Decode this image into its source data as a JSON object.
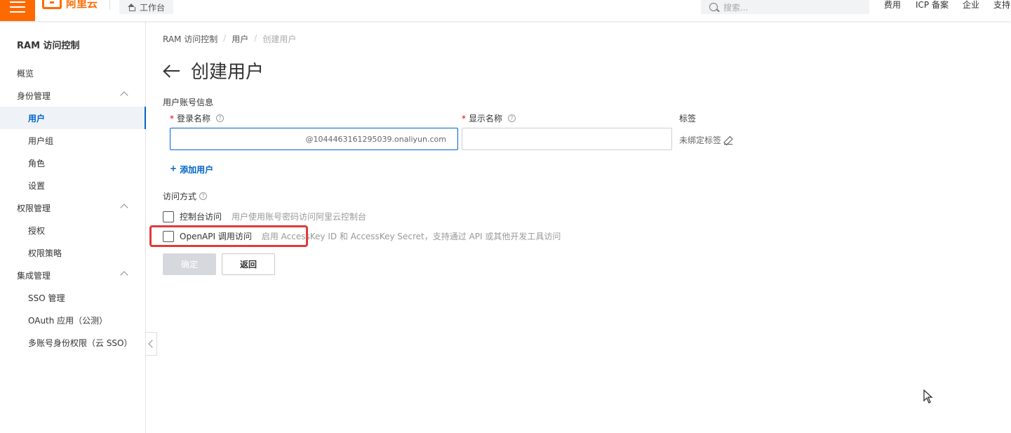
{
  "topbar": {
    "brand": "阿里云",
    "workbench": "工作台",
    "search_placeholder": "搜索...",
    "links": [
      "费用",
      "ICP 备案",
      "企业",
      "支持"
    ]
  },
  "sidebar": {
    "title": "RAM 访问控制",
    "items": [
      {
        "label": "概览"
      },
      {
        "label": "身份管理"
      },
      {
        "label": "用户"
      },
      {
        "label": "用户组"
      },
      {
        "label": "角色"
      },
      {
        "label": "设置"
      },
      {
        "label": "权限管理"
      },
      {
        "label": "授权"
      },
      {
        "label": "权限策略"
      },
      {
        "label": "集成管理"
      },
      {
        "label": "SSO 管理"
      },
      {
        "label": "OAuth 应用（公测）"
      },
      {
        "label": "多账号身份权限（云 SSO）"
      }
    ]
  },
  "breadcrumb": [
    "RAM 访问控制",
    "/",
    "用户",
    "/",
    "创建用户"
  ],
  "page": {
    "title": "创建用户",
    "account_section": "用户账号信息",
    "login_label": "登录名称",
    "login_suffix": "@1044463161295039.onaliyun.com",
    "display_label": "显示名称",
    "tag_label": "标签",
    "tag_value": "未绑定标签",
    "add_user": "添加用户",
    "access_section": "访问方式",
    "console_label": "控制台访问",
    "console_desc": "用户使用账号密码访问阿里云控制台",
    "api_label": "OpenAPI 调用访问",
    "api_desc": "启用 AccessKey ID 和 AccessKey Secret，支持通过 API 或其他开发工具访问",
    "ok_button": "确定",
    "back_button": "返回",
    "required_mark": "*",
    "help_mark": "?",
    "plus": "+"
  },
  "colors": {
    "brand": "#ff6a00",
    "link": "#0064c8",
    "highlight": "#e03b3b"
  }
}
